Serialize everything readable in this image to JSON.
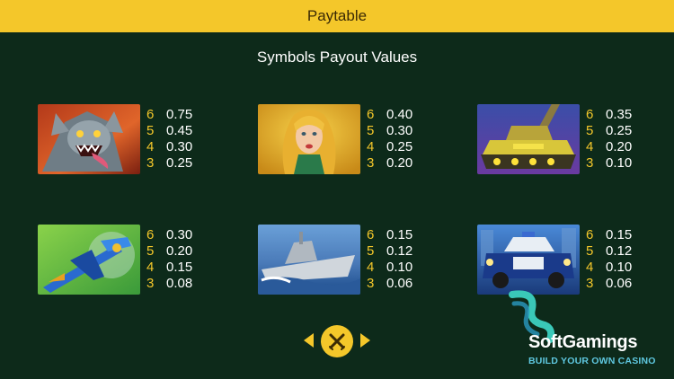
{
  "header": {
    "title": "Paytable"
  },
  "subtitle": "Symbols Payout Values",
  "symbols": [
    {
      "icon": "demon-monster-icon",
      "pays": [
        {
          "count": "6",
          "value": "0.75"
        },
        {
          "count": "5",
          "value": "0.45"
        },
        {
          "count": "4",
          "value": "0.30"
        },
        {
          "count": "3",
          "value": "0.25"
        }
      ]
    },
    {
      "icon": "blonde-woman-icon",
      "pays": [
        {
          "count": "6",
          "value": "0.40"
        },
        {
          "count": "5",
          "value": "0.30"
        },
        {
          "count": "4",
          "value": "0.25"
        },
        {
          "count": "3",
          "value": "0.20"
        }
      ]
    },
    {
      "icon": "tank-icon",
      "pays": [
        {
          "count": "6",
          "value": "0.35"
        },
        {
          "count": "5",
          "value": "0.25"
        },
        {
          "count": "4",
          "value": "0.20"
        },
        {
          "count": "3",
          "value": "0.10"
        }
      ]
    },
    {
      "icon": "airplane-icon",
      "pays": [
        {
          "count": "6",
          "value": "0.30"
        },
        {
          "count": "5",
          "value": "0.20"
        },
        {
          "count": "4",
          "value": "0.15"
        },
        {
          "count": "3",
          "value": "0.08"
        }
      ]
    },
    {
      "icon": "battleship-icon",
      "pays": [
        {
          "count": "6",
          "value": "0.15"
        },
        {
          "count": "5",
          "value": "0.12"
        },
        {
          "count": "4",
          "value": "0.10"
        },
        {
          "count": "3",
          "value": "0.06"
        }
      ]
    },
    {
      "icon": "police-car-icon",
      "pays": [
        {
          "count": "6",
          "value": "0.15"
        },
        {
          "count": "5",
          "value": "0.12"
        },
        {
          "count": "4",
          "value": "0.10"
        },
        {
          "count": "3",
          "value": "0.06"
        }
      ]
    }
  ],
  "navigation": {
    "prev_icon": "arrow-left-icon",
    "close_icon": "close-icon",
    "next_icon": "arrow-right-icon"
  },
  "logo": {
    "name": "SoftGamings",
    "tagline": "BUILD YOUR OWN CASINO"
  },
  "colors": {
    "accent": "#f4c72a",
    "background": "#0d2a1a",
    "text": "#ffffff",
    "logo_teal": "#5fc8e0"
  }
}
